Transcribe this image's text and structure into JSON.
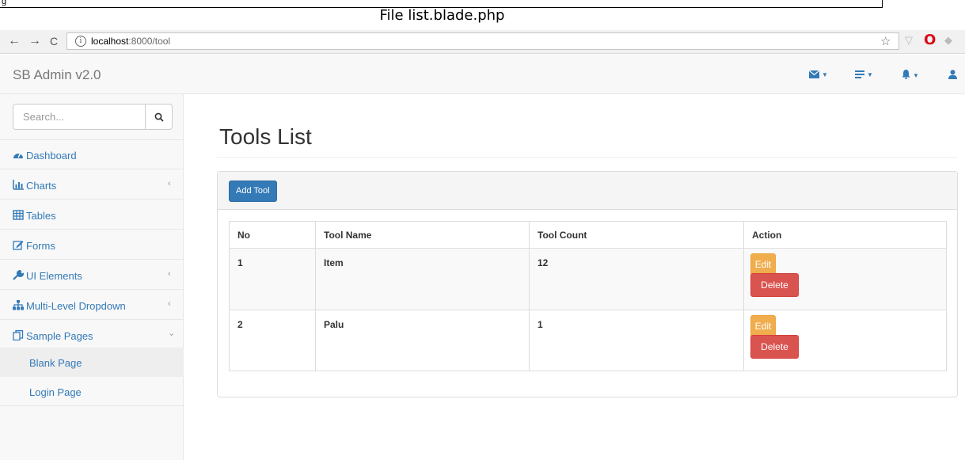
{
  "caption": {
    "title": "File list.blade.php"
  },
  "browser": {
    "back": "←",
    "forward": "→",
    "reload": "C",
    "url_host": "localhost",
    "url_path": ":8000/tool",
    "star": "☆"
  },
  "navbar": {
    "brand": "SB Admin v2.0"
  },
  "sidebar": {
    "search_placeholder": "Search...",
    "items": [
      {
        "label": "Dashboard",
        "icon": "dashboard-icon",
        "arrow": ""
      },
      {
        "label": "Charts",
        "icon": "bar-chart-icon",
        "arrow": "‹"
      },
      {
        "label": "Tables",
        "icon": "table-icon",
        "arrow": ""
      },
      {
        "label": "Forms",
        "icon": "edit-icon",
        "arrow": ""
      },
      {
        "label": "UI Elements",
        "icon": "wrench-icon",
        "arrow": "‹"
      },
      {
        "label": "Multi-Level Dropdown",
        "icon": "sitemap-icon",
        "arrow": "‹"
      },
      {
        "label": "Sample Pages",
        "icon": "files-icon",
        "arrow": "⌄"
      }
    ],
    "sub_items": [
      {
        "label": "Blank Page"
      },
      {
        "label": "Login Page"
      }
    ]
  },
  "main": {
    "title": "Tools List",
    "add_button": "Add Tool",
    "table": {
      "headers": [
        "No",
        "Tool Name",
        "Tool Count",
        "Action"
      ],
      "rows": [
        {
          "no": "1",
          "name": "Item",
          "count": "12",
          "edit": "Edit",
          "delete": "Delete"
        },
        {
          "no": "2",
          "name": "Palu",
          "count": "1",
          "edit": "Edit",
          "delete": "Delete"
        }
      ]
    }
  },
  "colors": {
    "primary": "#337ab7",
    "warning": "#f0ad4e",
    "danger": "#d9534f"
  }
}
